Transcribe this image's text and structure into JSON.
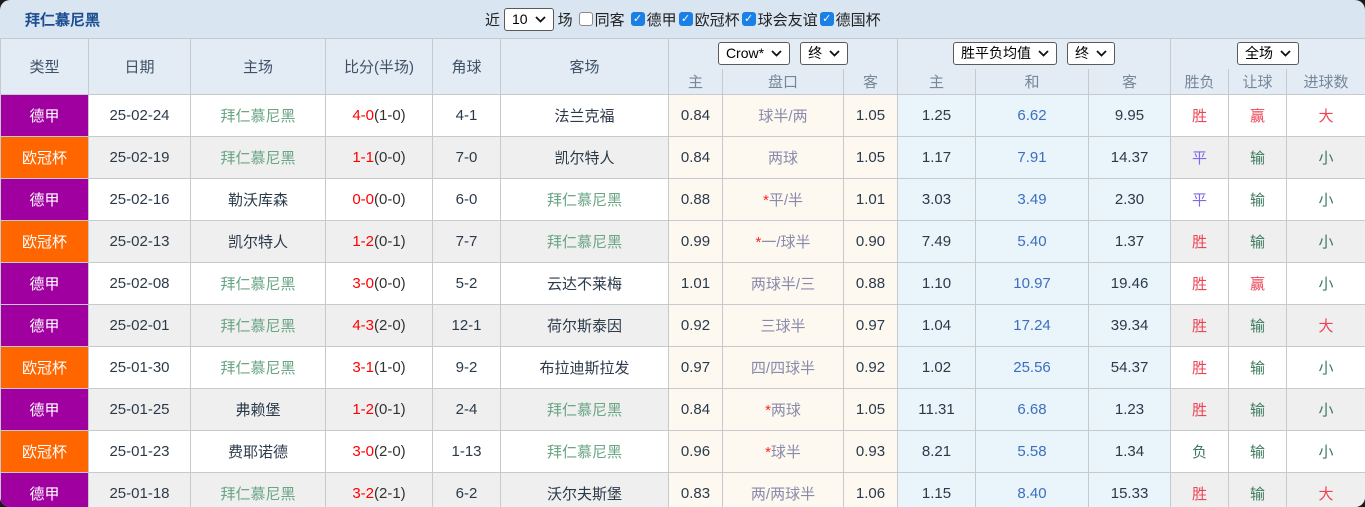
{
  "header": {
    "title": "拜仁慕尼黑",
    "near_label": "近",
    "matches_count": "10",
    "matches_unit": "场",
    "same_away_label": "同客",
    "same_away_checked": false,
    "league_filters": [
      {
        "label": "德甲",
        "checked": true
      },
      {
        "label": "欧冠杯",
        "checked": true
      },
      {
        "label": "球会友谊",
        "checked": true
      },
      {
        "label": "德国杯",
        "checked": true
      }
    ]
  },
  "table": {
    "main_headers": [
      "类型",
      "日期",
      "主场",
      "比分(半场)",
      "角球",
      "客场"
    ],
    "selects": {
      "bookmaker": "Crow*",
      "bookmaker_time": "终",
      "avg_metric": "胜平负均值",
      "avg_time": "终",
      "period": "全场"
    },
    "sub_headers": [
      "主",
      "盘口",
      "客",
      "主",
      "和",
      "客",
      "胜负",
      "让球",
      "进球数"
    ],
    "rows": [
      {
        "type": "德甲",
        "type_class": "purple",
        "date": "25-02-24",
        "home": "拜仁慕尼黑",
        "home_green": true,
        "score": "4-0",
        "half": "(1-0)",
        "corner": "4-1",
        "away": "法兰克福",
        "away_green": false,
        "odds_home": "0.84",
        "handicap_star": false,
        "handicap": "球半/两",
        "odds_away": "1.05",
        "avg_win": "1.25",
        "avg_draw": "6.62",
        "avg_lose": "9.95",
        "result": "胜",
        "result_class": "res-red",
        "let_ball": "赢",
        "let_class": "res-red",
        "goals": "大",
        "goals_class": "res-red"
      },
      {
        "type": "欧冠杯",
        "type_class": "orange",
        "date": "25-02-19",
        "home": "拜仁慕尼黑",
        "home_green": true,
        "score": "1-1",
        "half": "(0-0)",
        "corner": "7-0",
        "away": "凯尔特人",
        "away_green": false,
        "odds_home": "0.84",
        "handicap_star": false,
        "handicap": "两球",
        "odds_away": "1.05",
        "avg_win": "1.17",
        "avg_draw": "7.91",
        "avg_lose": "14.37",
        "result": "平",
        "result_class": "res-blue",
        "let_ball": "输",
        "let_class": "res-green",
        "goals": "小",
        "goals_class": "res-green"
      },
      {
        "type": "德甲",
        "type_class": "purple",
        "date": "25-02-16",
        "home": "勒沃库森",
        "home_green": false,
        "score": "0-0",
        "half": "(0-0)",
        "corner": "6-0",
        "away": "拜仁慕尼黑",
        "away_green": true,
        "odds_home": "0.88",
        "handicap_star": true,
        "handicap": "平/半",
        "odds_away": "1.01",
        "avg_win": "3.03",
        "avg_draw": "3.49",
        "avg_lose": "2.30",
        "result": "平",
        "result_class": "res-blue",
        "let_ball": "输",
        "let_class": "res-green",
        "goals": "小",
        "goals_class": "res-green"
      },
      {
        "type": "欧冠杯",
        "type_class": "orange",
        "date": "25-02-13",
        "home": "凯尔特人",
        "home_green": false,
        "score": "1-2",
        "half": "(0-1)",
        "corner": "7-7",
        "away": "拜仁慕尼黑",
        "away_green": true,
        "odds_home": "0.99",
        "handicap_star": true,
        "handicap": "一/球半",
        "odds_away": "0.90",
        "avg_win": "7.49",
        "avg_draw": "5.40",
        "avg_lose": "1.37",
        "result": "胜",
        "result_class": "res-red",
        "let_ball": "输",
        "let_class": "res-green",
        "goals": "小",
        "goals_class": "res-green"
      },
      {
        "type": "德甲",
        "type_class": "purple",
        "date": "25-02-08",
        "home": "拜仁慕尼黑",
        "home_green": true,
        "score": "3-0",
        "half": "(0-0)",
        "corner": "5-2",
        "away": "云达不莱梅",
        "away_green": false,
        "odds_home": "1.01",
        "handicap_star": false,
        "handicap": "两球半/三",
        "odds_away": "0.88",
        "avg_win": "1.10",
        "avg_draw": "10.97",
        "avg_lose": "19.46",
        "result": "胜",
        "result_class": "res-red",
        "let_ball": "赢",
        "let_class": "res-red",
        "goals": "小",
        "goals_class": "res-green"
      },
      {
        "type": "德甲",
        "type_class": "purple",
        "date": "25-02-01",
        "home": "拜仁慕尼黑",
        "home_green": true,
        "score": "4-3",
        "half": "(2-0)",
        "corner": "12-1",
        "away": "荷尔斯泰因",
        "away_green": false,
        "odds_home": "0.92",
        "handicap_star": false,
        "handicap": "三球半",
        "odds_away": "0.97",
        "avg_win": "1.04",
        "avg_draw": "17.24",
        "avg_lose": "39.34",
        "result": "胜",
        "result_class": "res-red",
        "let_ball": "输",
        "let_class": "res-green",
        "goals": "大",
        "goals_class": "res-red"
      },
      {
        "type": "欧冠杯",
        "type_class": "orange",
        "date": "25-01-30",
        "home": "拜仁慕尼黑",
        "home_green": true,
        "score": "3-1",
        "half": "(1-0)",
        "corner": "9-2",
        "away": "布拉迪斯拉发",
        "away_green": false,
        "odds_home": "0.97",
        "handicap_star": false,
        "handicap": "四/四球半",
        "odds_away": "0.92",
        "avg_win": "1.02",
        "avg_draw": "25.56",
        "avg_lose": "54.37",
        "result": "胜",
        "result_class": "res-red",
        "let_ball": "输",
        "let_class": "res-green",
        "goals": "小",
        "goals_class": "res-green"
      },
      {
        "type": "德甲",
        "type_class": "purple",
        "date": "25-01-25",
        "home": "弗赖堡",
        "home_green": false,
        "score": "1-2",
        "half": "(0-1)",
        "corner": "2-4",
        "away": "拜仁慕尼黑",
        "away_green": true,
        "odds_home": "0.84",
        "handicap_star": true,
        "handicap": "两球",
        "odds_away": "1.05",
        "avg_win": "11.31",
        "avg_draw": "6.68",
        "avg_lose": "1.23",
        "result": "胜",
        "result_class": "res-red",
        "let_ball": "输",
        "let_class": "res-green",
        "goals": "小",
        "goals_class": "res-green"
      },
      {
        "type": "欧冠杯",
        "type_class": "orange",
        "date": "25-01-23",
        "home": "费耶诺德",
        "home_green": false,
        "score": "3-0",
        "half": "(2-0)",
        "corner": "1-13",
        "away": "拜仁慕尼黑",
        "away_green": true,
        "odds_home": "0.96",
        "handicap_star": true,
        "handicap": "球半",
        "odds_away": "0.93",
        "avg_win": "8.21",
        "avg_draw": "5.58",
        "avg_lose": "1.34",
        "result": "负",
        "result_class": "res-green",
        "let_ball": "输",
        "let_class": "res-green",
        "goals": "小",
        "goals_class": "res-green"
      },
      {
        "type": "德甲",
        "type_class": "purple",
        "date": "25-01-18",
        "home": "拜仁慕尼黑",
        "home_green": true,
        "score": "3-2",
        "half": "(2-1)",
        "corner": "6-2",
        "away": "沃尔夫斯堡",
        "away_green": false,
        "odds_home": "0.83",
        "handicap_star": false,
        "handicap": "两/两球半",
        "odds_away": "1.06",
        "avg_win": "1.15",
        "avg_draw": "8.40",
        "avg_lose": "15.33",
        "result": "胜",
        "result_class": "res-red",
        "let_ball": "输",
        "let_class": "res-green",
        "goals": "大",
        "goals_class": "res-red"
      }
    ]
  },
  "colors": {
    "page_bg": "#d9e6f2",
    "badge_purple": "#a000a0",
    "badge_orange": "#ff6600",
    "team_green": "#6aa584",
    "score_red": "#ff0000",
    "result_red": "#ee4455",
    "result_blue": "#7b68ee",
    "result_green": "#3d7a5e",
    "avg_blue_text": "#3d6fbe",
    "avg_col_bg": "#e9f4fb",
    "handicap_col_bg": "#fdf9f1",
    "checkbox_blue": "#1a80e5"
  }
}
